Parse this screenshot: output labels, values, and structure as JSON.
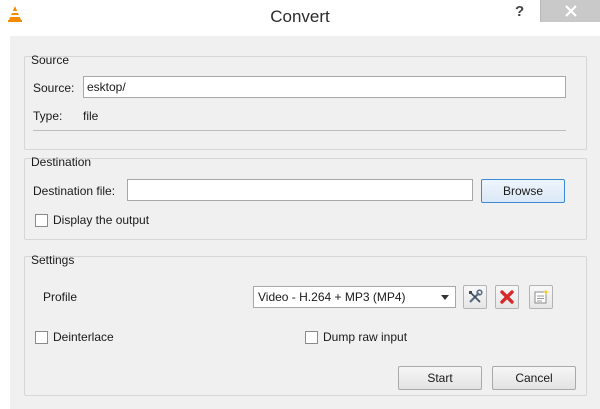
{
  "window": {
    "title": "Convert",
    "help_label": "?",
    "icons": {
      "app": "vlc-cone-icon",
      "close": "close-icon"
    }
  },
  "source": {
    "group_title": "Source",
    "source_label": "Source:",
    "source_value": "esktop/",
    "type_label": "Type:",
    "type_value": "file"
  },
  "destination": {
    "group_title": "Destination",
    "file_label": "Destination file:",
    "file_value": "",
    "browse_label": "Browse",
    "display_output_label": "Display the output",
    "display_output_checked": false
  },
  "settings": {
    "group_title": "Settings",
    "profile_label": "Profile",
    "profile_selected": "Video - H.264 + MP3 (MP4)",
    "profile_tools": [
      "wrench-screwdriver-icon",
      "red-x-delete-icon",
      "new-profile-icon"
    ],
    "deinterlace_label": "Deinterlace",
    "deinterlace_checked": false,
    "dump_raw_label": "Dump raw input",
    "dump_raw_checked": false
  },
  "footer": {
    "start_label": "Start",
    "cancel_label": "Cancel"
  },
  "colors": {
    "vlc_orange": "#f48b00",
    "focus_blue": "#3b8ad6",
    "delete_red": "#d62a2a",
    "dialog_bg": "#f0f0f0"
  }
}
